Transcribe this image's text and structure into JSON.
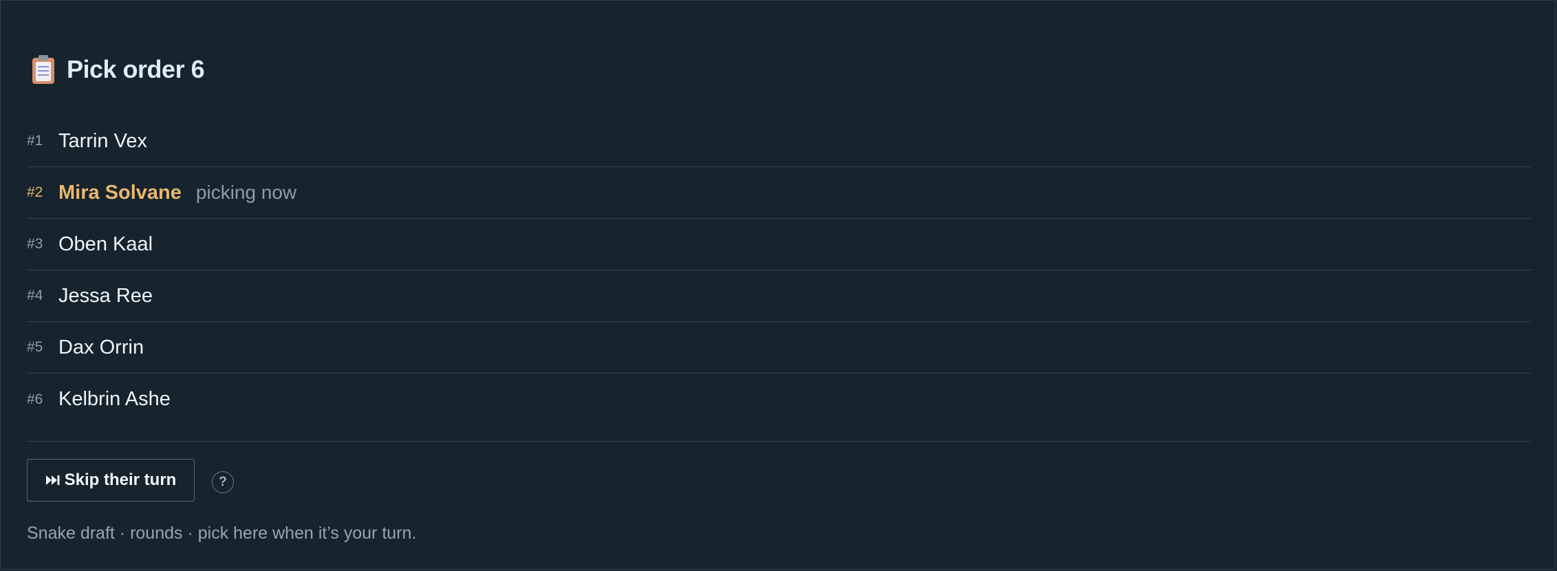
{
  "header": {
    "icon": "clipboard-icon",
    "title": "Pick order 6"
  },
  "pick_order": [
    {
      "rank": "#1",
      "name": "Tarrin Vex",
      "status": ""
    },
    {
      "rank": "#2",
      "name": "Mira Solvane",
      "status": "picking now",
      "current": true
    },
    {
      "rank": "#3",
      "name": "Oben Kaal",
      "status": ""
    },
    {
      "rank": "#4",
      "name": "Jessa Ree",
      "status": ""
    },
    {
      "rank": "#5",
      "name": "Dax Orrin",
      "status": ""
    },
    {
      "rank": "#6",
      "name": "Kelbrin Ashe",
      "status": ""
    }
  ],
  "actions": {
    "skip_label": "Skip their turn",
    "skip_icon": "skip-forward-icon",
    "help_label": "?"
  },
  "footer": {
    "note": "Snake draft · rounds · pick here when it’s your turn."
  },
  "colors": {
    "background": "#17232d",
    "current_picker": "#e8b86f",
    "text": "#eef6fa",
    "muted": "#8e9ea6"
  }
}
